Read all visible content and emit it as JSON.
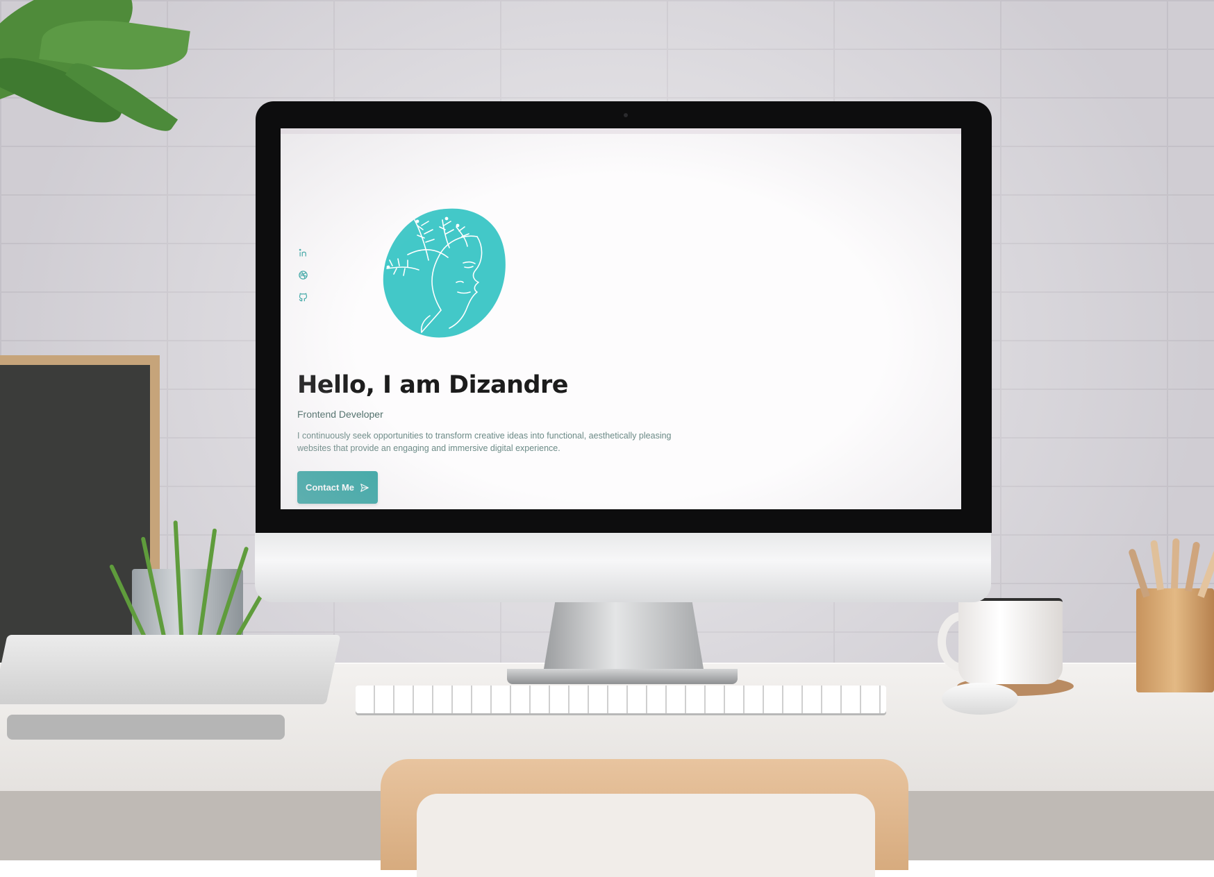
{
  "page": {
    "hero": {
      "title": "Hello, I am Dizandre",
      "subtitle": "Frontend Developer",
      "description": "I continuously seek opportunities to transform creative ideas into functional, aesthetically pleasing websites that provide an engaging and immersive digital experience.",
      "contact_button_label": "Contact Me"
    },
    "social_links": [
      {
        "icon": "linkedin-icon"
      },
      {
        "icon": "dribbble-icon"
      },
      {
        "icon": "github-icon"
      }
    ],
    "avatar": {
      "icon": "line-art-face-with-leaves-illustration"
    }
  },
  "colors": {
    "accent": "#3aa8a6",
    "avatar_blob": "#43c8c8",
    "title_text": "#1c1c1c",
    "subtitle_text": "#4e6e69",
    "body_text": "#6b8a86",
    "screen_background": "#fdfcfd"
  }
}
